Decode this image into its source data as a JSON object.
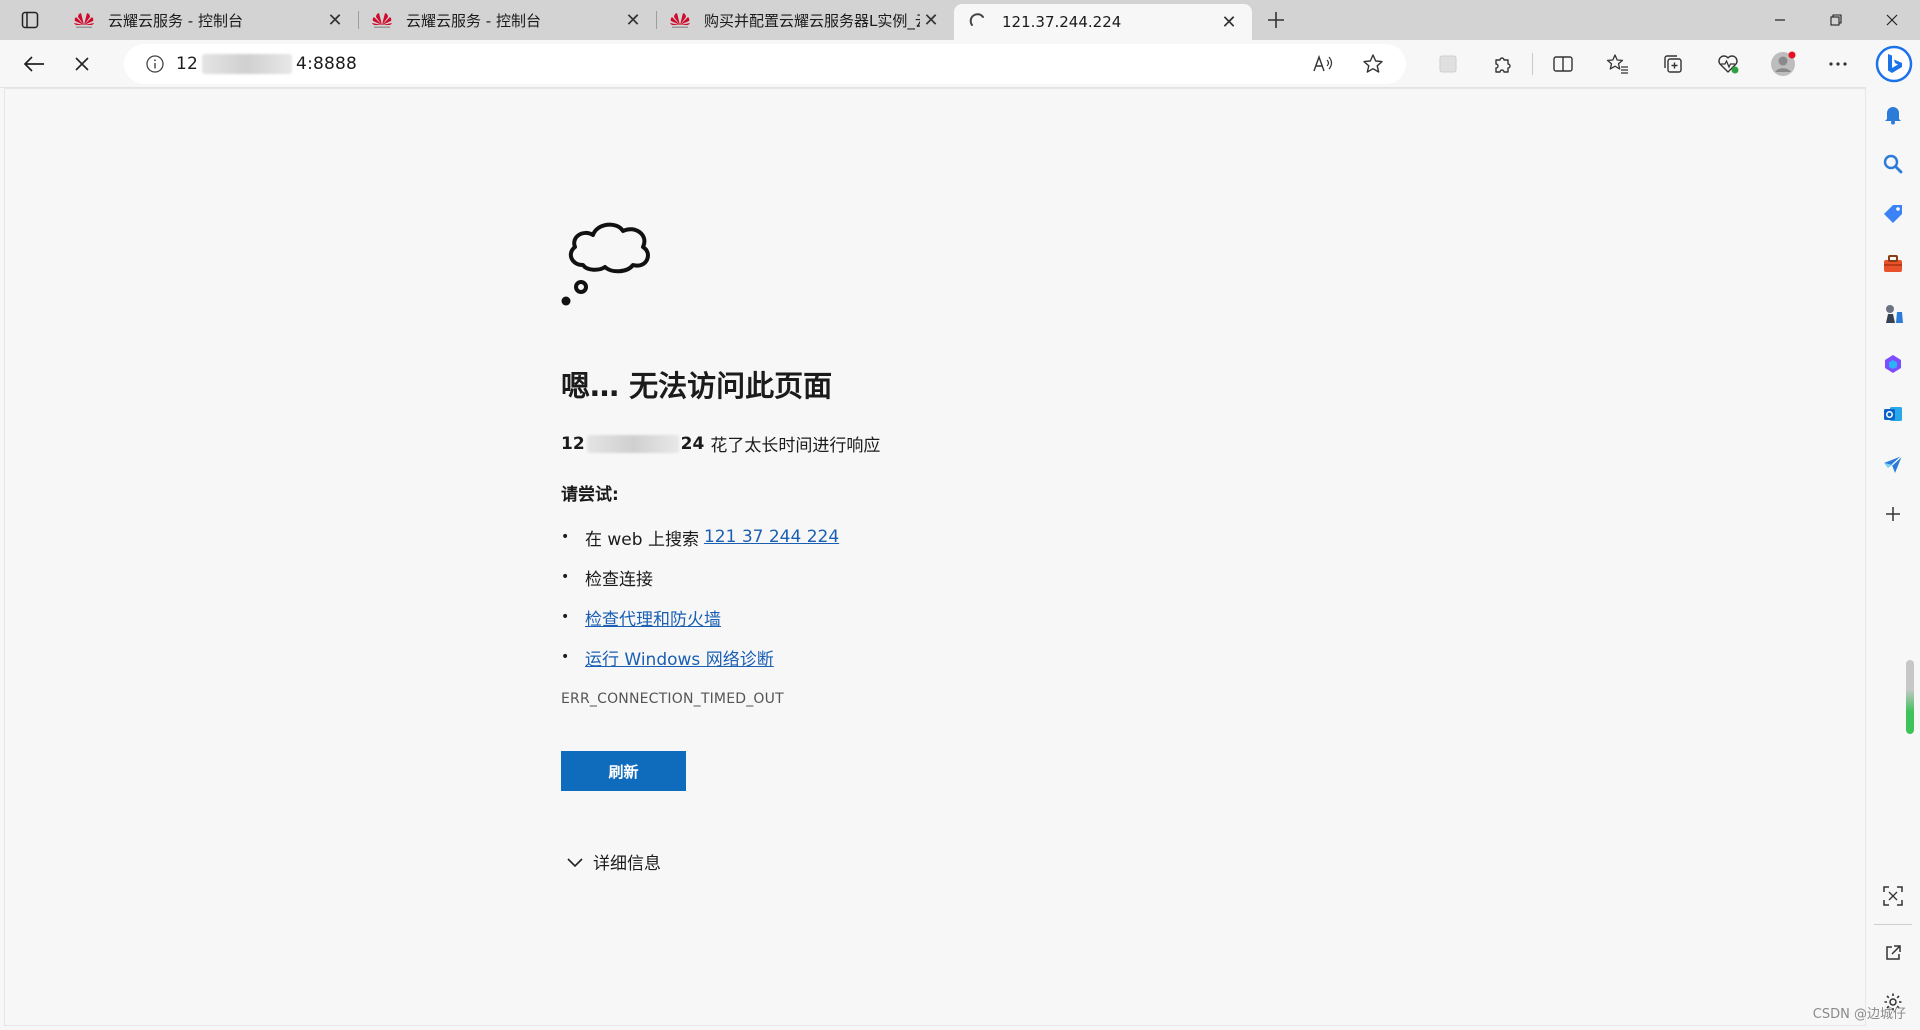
{
  "tabs": [
    {
      "title": "云耀云服务 - 控制台",
      "icon": "huawei-logo"
    },
    {
      "title": "云耀云服务 - 控制台",
      "icon": "huawei-logo"
    },
    {
      "title": "购买并配置云耀云服务器L实例_云",
      "icon": "huawei-logo"
    },
    {
      "title": "121.37.244.224",
      "icon": "loading-spinner",
      "active": true
    }
  ],
  "address": {
    "prefix": "12",
    "suffix": "4:8888"
  },
  "error": {
    "heading": "嗯… 无法访问此页面",
    "host_prefix": "12",
    "host_suffix": "24",
    "message": "花了太长时间进行响应",
    "try_label": "请尝试:",
    "search_prefix": "在 web 上搜索",
    "search_link": "121 37 244 224",
    "check_connection": "检查连接",
    "check_proxy": "检查代理和防火墙",
    "run_diagnostics": "运行 Windows 网络诊断",
    "code": "ERR_CONNECTION_TIMED_OUT",
    "refresh_label": "刷新",
    "details_label": "详细信息"
  },
  "watermark": "CSDN @边城仔",
  "colors": {
    "accent": "#0f6cbd",
    "link": "#1a5fb4",
    "huawei_red": "#cf0a2c"
  }
}
